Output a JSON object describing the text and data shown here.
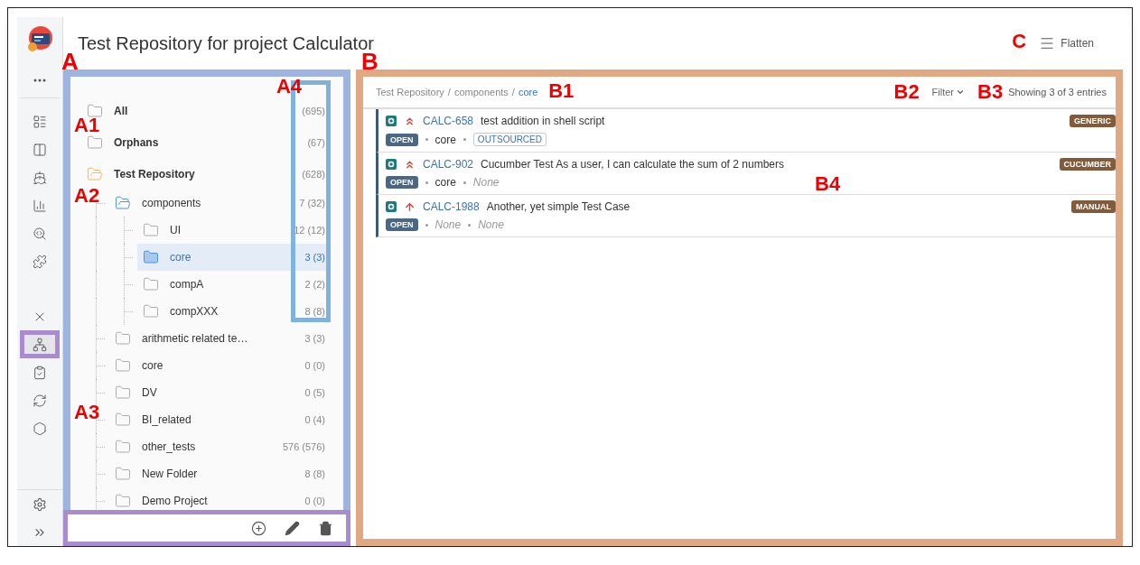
{
  "page_title": "Test Repository for project Calculator",
  "flatten": {
    "label": "Flatten",
    "annotation": "C"
  },
  "sidebar": {
    "items": [
      {
        "kind": "more",
        "selected": false
      },
      {
        "kind": "boards",
        "selected": false
      },
      {
        "kind": "columns",
        "selected": false
      },
      {
        "kind": "ship",
        "selected": false
      },
      {
        "kind": "reports",
        "selected": false
      },
      {
        "kind": "search",
        "selected": false
      },
      {
        "kind": "puzzle",
        "selected": false
      },
      {
        "kind": "tools",
        "selected": false
      },
      {
        "kind": "repository",
        "selected": true
      },
      {
        "kind": "checklist",
        "selected": false
      },
      {
        "kind": "sync",
        "selected": false
      },
      {
        "kind": "hexagon",
        "selected": false
      }
    ],
    "bottom": [
      {
        "kind": "settings"
      },
      {
        "kind": "expand"
      }
    ]
  },
  "tree_panel": {
    "annotation": "A",
    "count_annotation": "A4",
    "items": [
      {
        "label": "All",
        "count": "(695)",
        "selected": false
      },
      {
        "label": "Orphans",
        "count": "(67)",
        "selected": false,
        "annotation": "A1"
      },
      {
        "label": "Test Repository",
        "count": "(628)",
        "selected": false,
        "expanded": true,
        "children": [
          {
            "label": "components",
            "count": "7 (32)",
            "selected": false,
            "expanded": true,
            "annotation": "A2",
            "children": [
              {
                "label": "UI",
                "count": "12 (12)",
                "selected": false
              },
              {
                "label": "core",
                "count": "3 (3)",
                "selected": true
              },
              {
                "label": "compA",
                "count": "2 (2)",
                "selected": false
              },
              {
                "label": "compXXX",
                "count": "8 (8)",
                "selected": false
              }
            ]
          },
          {
            "label": "arithmetic related te…",
            "count": "3 (3)",
            "selected": false
          },
          {
            "label": "core",
            "count": "0 (0)",
            "selected": false
          },
          {
            "label": "DV",
            "count": "0 (5)",
            "selected": false
          },
          {
            "label": "BI_related",
            "count": "0 (4)",
            "selected": false,
            "annotation": "A3"
          },
          {
            "label": "other_tests",
            "count": "576 (576)",
            "selected": false
          },
          {
            "label": "New Folder",
            "count": "8 (8)",
            "selected": false
          },
          {
            "label": "Demo Project",
            "count": "0 (0)",
            "selected": false
          }
        ]
      }
    ],
    "actions": [
      {
        "kind": "add"
      },
      {
        "kind": "edit"
      },
      {
        "kind": "delete"
      }
    ]
  },
  "tests_panel": {
    "annotation": "B",
    "breadcrumb": [
      {
        "kind": "link",
        "text": "Test Repository"
      },
      {
        "kind": "separator",
        "text": "/"
      },
      {
        "kind": "link",
        "text": "components"
      },
      {
        "kind": "separator",
        "text": "/"
      },
      {
        "kind": "current",
        "text": "core"
      }
    ],
    "breadcrumb_annotation": "B1",
    "filter": {
      "label": "Filter",
      "annotation": "B2"
    },
    "entries": {
      "text": "Showing 3 of 3 entries",
      "annotation": "B3"
    },
    "list_annotation": "B4",
    "tests": [
      {
        "key": "CALC-658",
        "summary": "test addition in shell script",
        "kind": "highest-priority",
        "type": "GENERIC",
        "status": "OPEN",
        "fields": [
          {
            "kind": "text",
            "text": "core"
          },
          {
            "kind": "label",
            "text": "OUTSOURCED"
          }
        ]
      },
      {
        "key": "CALC-902",
        "summary": "Cucumber Test As a user, I can calculate the sum of 2 numbers",
        "kind": "highest-priority",
        "type": "CUCUMBER",
        "status": "OPEN",
        "fields": [
          {
            "kind": "text",
            "text": "core"
          },
          {
            "kind": "empty",
            "text": "None"
          }
        ]
      },
      {
        "key": "CALC-1988",
        "summary": "Another, yet simple Test Case",
        "kind": "high-priority",
        "type": "MANUAL",
        "status": "OPEN",
        "fields": [
          {
            "kind": "empty",
            "text": "None"
          },
          {
            "kind": "empty",
            "text": "None"
          }
        ]
      }
    ]
  }
}
